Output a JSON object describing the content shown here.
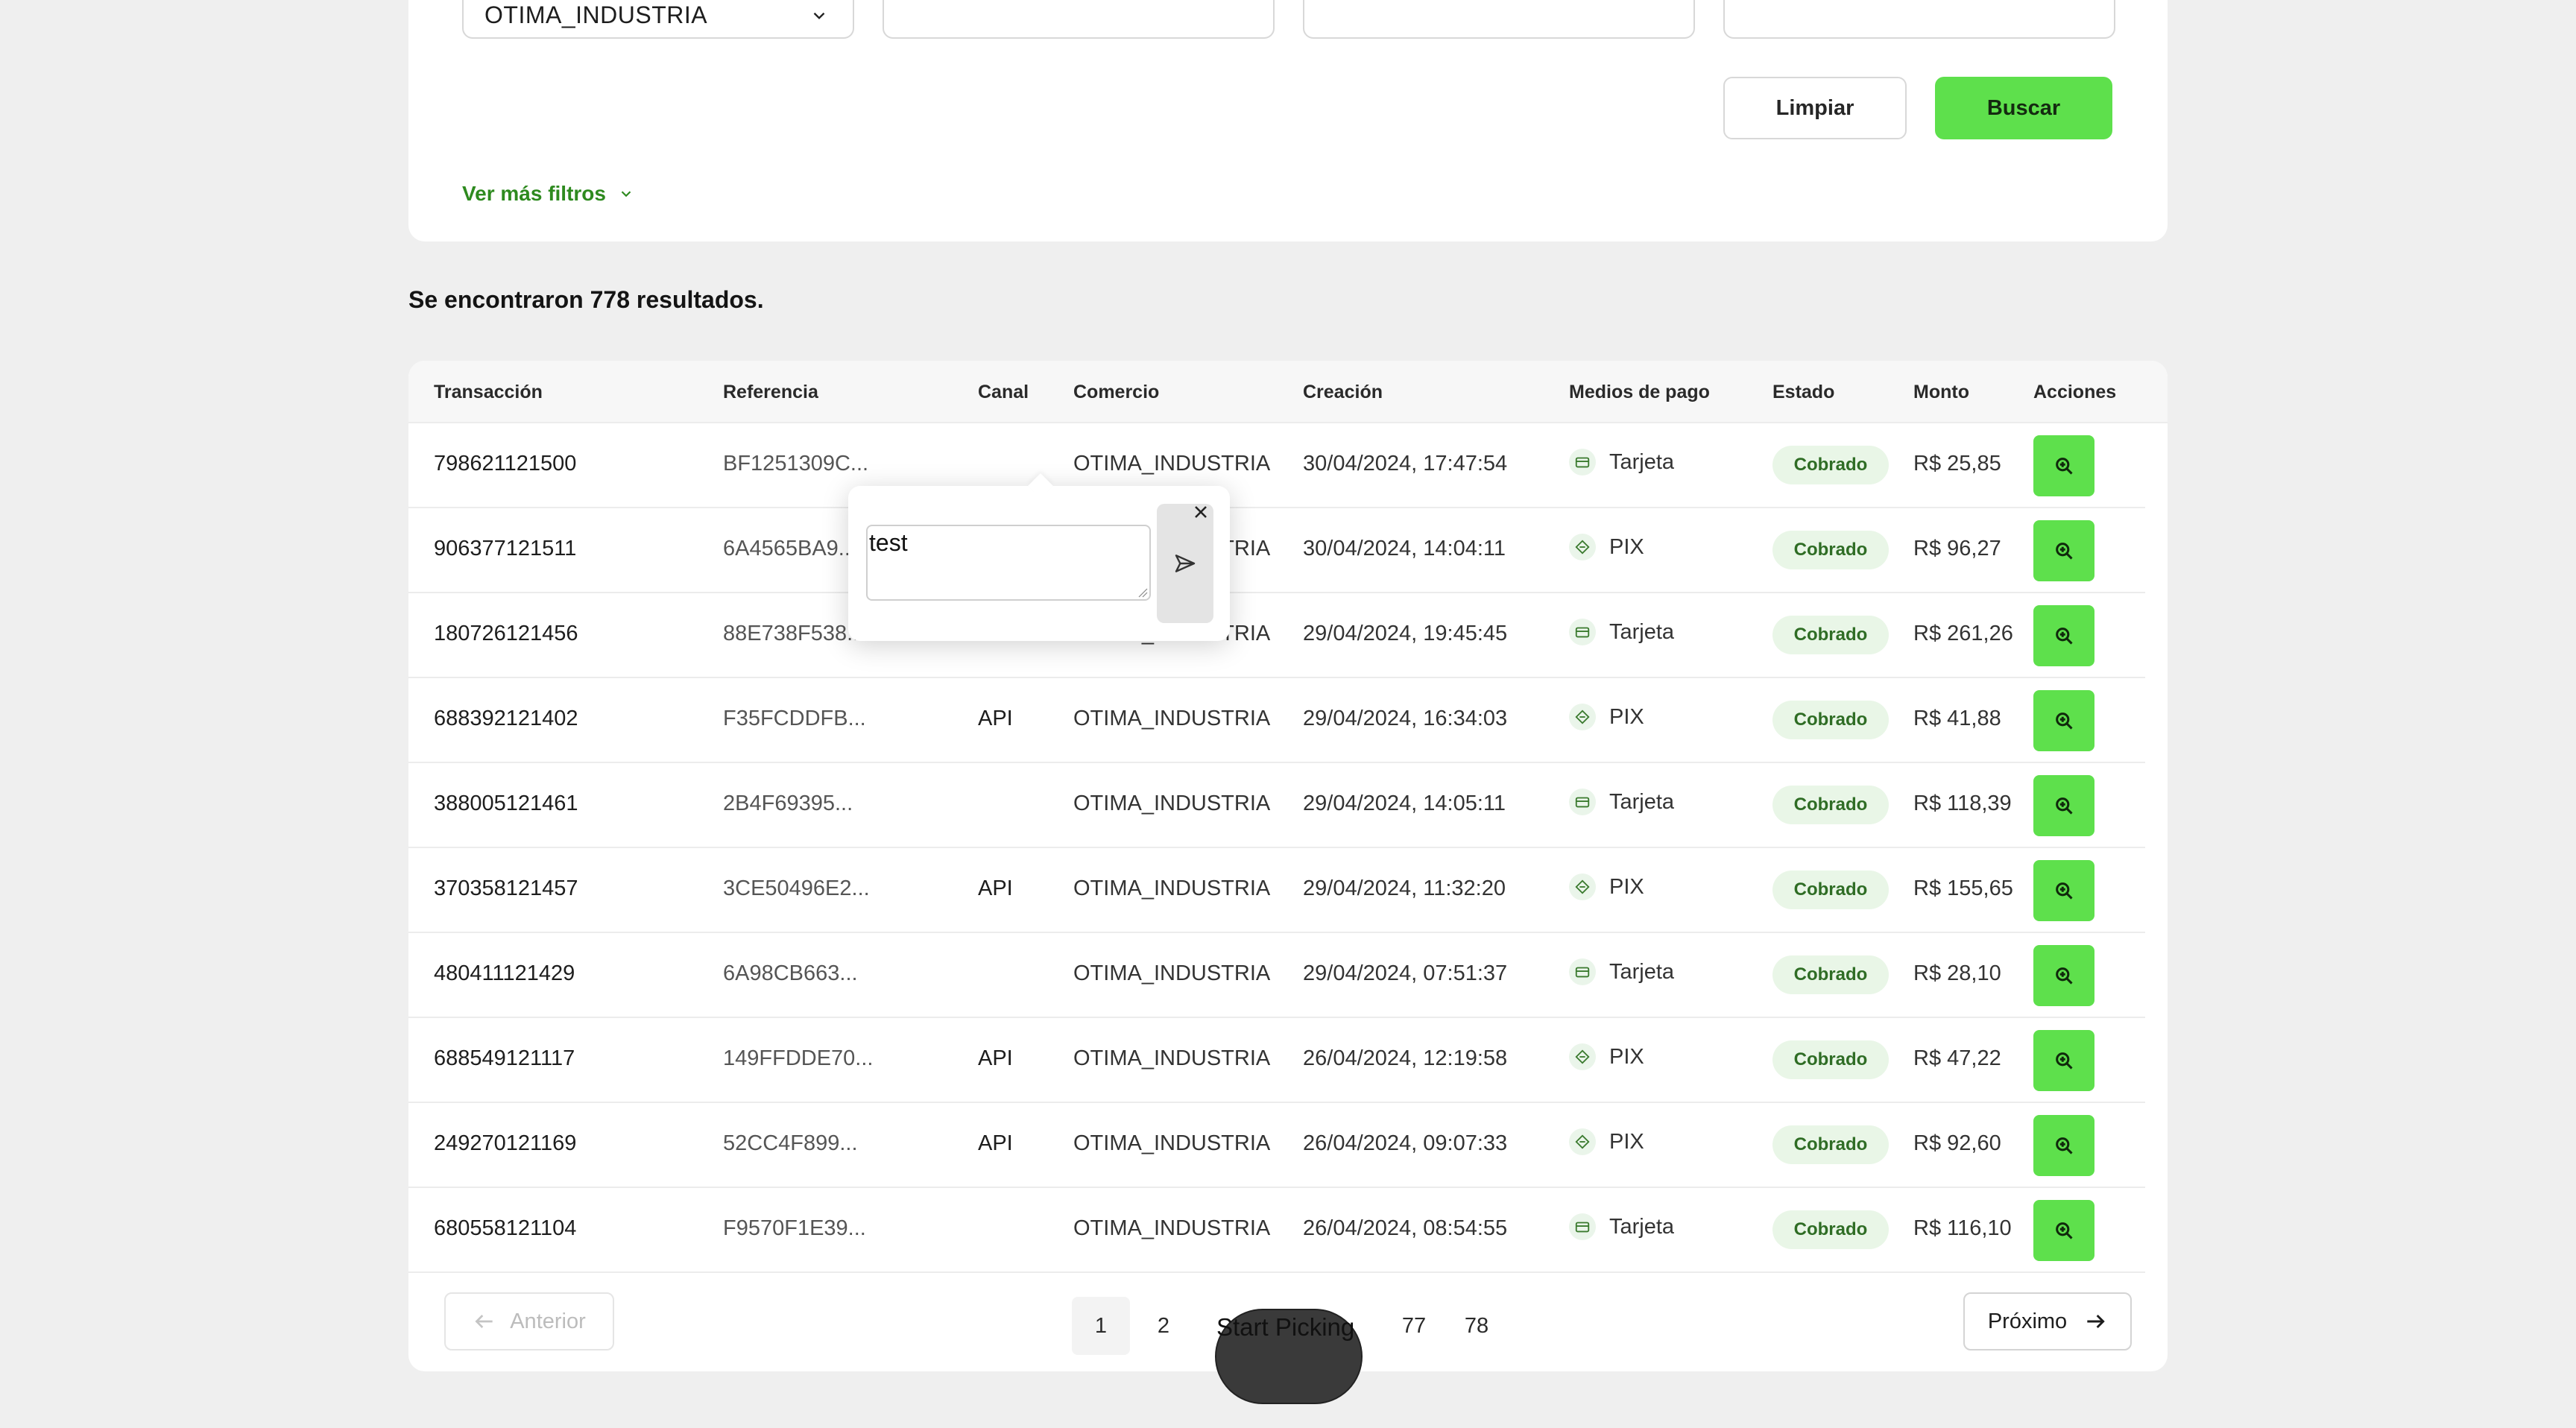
{
  "filters": {
    "merchant_select_value": "OTIMA_INDUSTRIA",
    "clear_label": "Limpiar",
    "search_label": "Buscar",
    "more_filters_label": "Ver más filtros"
  },
  "results_count": "Se encontraron 778 resultados.",
  "table": {
    "columns": [
      "Transacción",
      "Referencia",
      "Canal",
      "Comercio",
      "Creación",
      "Medios de pago",
      "Estado",
      "Monto",
      "Acciones"
    ],
    "rows": [
      {
        "transaction": "798621121500",
        "reference": "BF1251309C...",
        "channel": "",
        "merchant": "OTIMA_INDUSTRIA",
        "created": "30/04/2024, 17:47:54",
        "payment": "Tarjeta",
        "payment_icon": "card-icon",
        "status": "Cobrado",
        "amount": "R$ 25,85"
      },
      {
        "transaction": "906377121511",
        "reference": "6A4565BA9...",
        "channel": "",
        "merchant": "OTIMA_INDUSTRIA",
        "created": "30/04/2024, 14:04:11",
        "payment": "PIX",
        "payment_icon": "pix-icon",
        "status": "Cobrado",
        "amount": "R$ 96,27"
      },
      {
        "transaction": "180726121456",
        "reference": "88E738F538...",
        "channel": "",
        "merchant": "OTIMA_INDUSTRIA",
        "created": "29/04/2024, 19:45:45",
        "payment": "Tarjeta",
        "payment_icon": "card-icon",
        "status": "Cobrado",
        "amount": "R$ 261,26"
      },
      {
        "transaction": "688392121402",
        "reference": "F35FCDDFB...",
        "channel": "API",
        "merchant": "OTIMA_INDUSTRIA",
        "created": "29/04/2024, 16:34:03",
        "payment": "PIX",
        "payment_icon": "pix-icon",
        "status": "Cobrado",
        "amount": "R$ 41,88"
      },
      {
        "transaction": "388005121461",
        "reference": "2B4F69395...",
        "channel": "",
        "merchant": "OTIMA_INDUSTRIA",
        "created": "29/04/2024, 14:05:11",
        "payment": "Tarjeta",
        "payment_icon": "card-icon",
        "status": "Cobrado",
        "amount": "R$ 118,39"
      },
      {
        "transaction": "370358121457",
        "reference": "3CE50496E2...",
        "channel": "API",
        "merchant": "OTIMA_INDUSTRIA",
        "created": "29/04/2024, 11:32:20",
        "payment": "PIX",
        "payment_icon": "pix-icon",
        "status": "Cobrado",
        "amount": "R$ 155,65"
      },
      {
        "transaction": "480411121429",
        "reference": "6A98CB663...",
        "channel": "",
        "merchant": "OTIMA_INDUSTRIA",
        "created": "29/04/2024, 07:51:37",
        "payment": "Tarjeta",
        "payment_icon": "card-icon",
        "status": "Cobrado",
        "amount": "R$ 28,10"
      },
      {
        "transaction": "688549121117",
        "reference": "149FFDDE70...",
        "channel": "API",
        "merchant": "OTIMA_INDUSTRIA",
        "created": "26/04/2024, 12:19:58",
        "payment": "PIX",
        "payment_icon": "pix-icon",
        "status": "Cobrado",
        "amount": "R$ 47,22"
      },
      {
        "transaction": "249270121169",
        "reference": "52CC4F899...",
        "channel": "API",
        "merchant": "OTIMA_INDUSTRIA",
        "created": "26/04/2024, 09:07:33",
        "payment": "PIX",
        "payment_icon": "pix-icon",
        "status": "Cobrado",
        "amount": "R$ 92,60"
      },
      {
        "transaction": "680558121104",
        "reference": "F9570F1E39...",
        "channel": "",
        "merchant": "OTIMA_INDUSTRIA",
        "created": "26/04/2024, 08:54:55",
        "payment": "Tarjeta",
        "payment_icon": "card-icon",
        "status": "Cobrado",
        "amount": "R$ 116,10"
      }
    ]
  },
  "pagination": {
    "prev_label": "Anterior",
    "next_label": "Próximo",
    "pages": [
      "1",
      "2",
      "77",
      "78"
    ],
    "current_page": "1"
  },
  "popover": {
    "comment_value": "test"
  },
  "overlay": {
    "start_picking_label": "Start Picking"
  },
  "colors": {
    "accent": "#5ee04c",
    "link": "#2e8a1f",
    "badge_bg": "#e9f6e7",
    "badge_text": "#2f6d25",
    "page_bg": "#efefef"
  }
}
